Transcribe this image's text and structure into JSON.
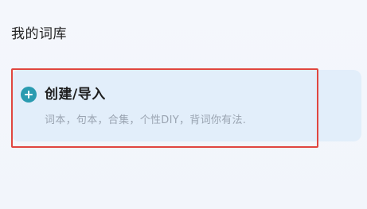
{
  "section": {
    "title": "我的词库"
  },
  "create_card": {
    "icon": "plus-circle-icon",
    "title": "创建/导入",
    "description": "词本，句本，合集，个性DIY，背词你有法.",
    "accent_color": "#2a9bb0",
    "highlight_color": "#e0463f"
  }
}
